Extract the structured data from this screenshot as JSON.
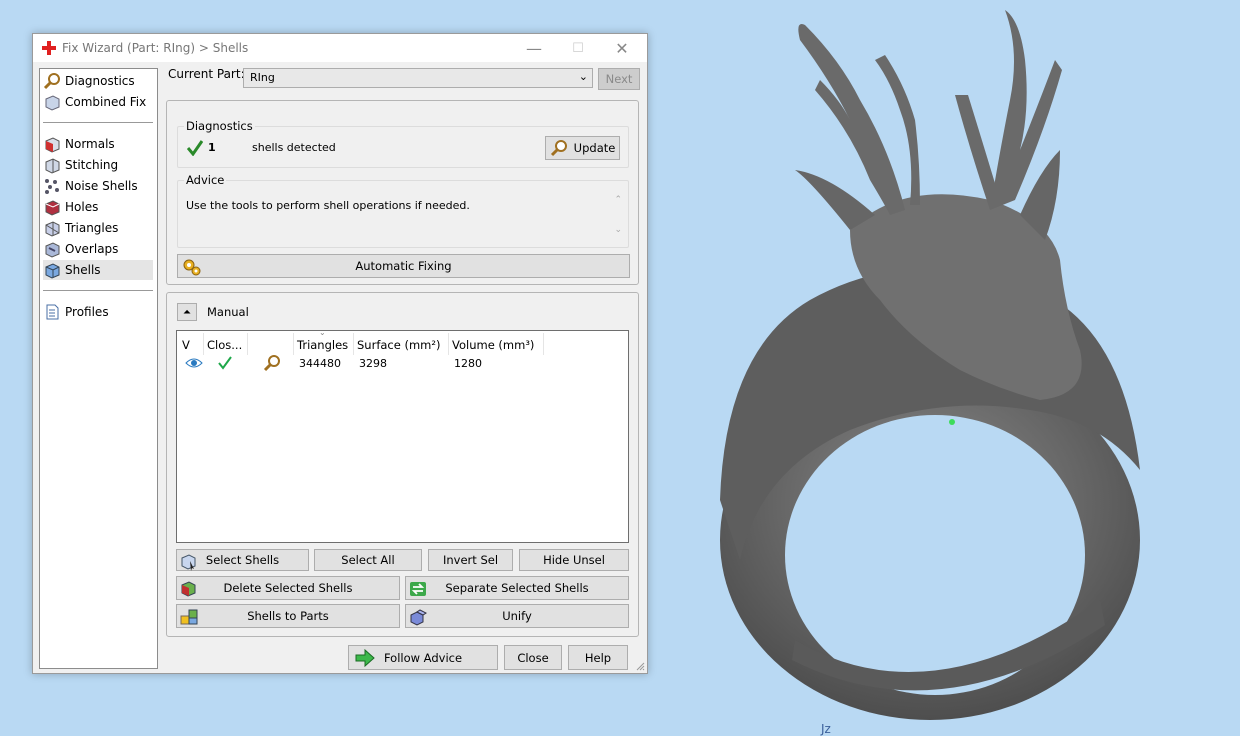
{
  "window": {
    "title": "Fix Wizard (Part: RIng) > Shells",
    "minimize": "—",
    "maximize": "☐",
    "close": "✕"
  },
  "sidebar": {
    "items": [
      {
        "label": "Diagnostics",
        "icon": "magnifier-icon"
      },
      {
        "label": "Combined Fix",
        "icon": "combined-fix-icon"
      },
      {
        "label": "Normals",
        "icon": "normals-icon"
      },
      {
        "label": "Stitching",
        "icon": "stitching-icon"
      },
      {
        "label": "Noise Shells",
        "icon": "noise-shells-icon"
      },
      {
        "label": "Holes",
        "icon": "holes-icon"
      },
      {
        "label": "Triangles",
        "icon": "triangles-icon"
      },
      {
        "label": "Overlaps",
        "icon": "overlaps-icon"
      },
      {
        "label": "Shells",
        "icon": "shells-icon"
      },
      {
        "label": "Profiles",
        "icon": "profiles-icon"
      }
    ],
    "selected": "Shells"
  },
  "current_part": {
    "label": "Current Part:",
    "value": "RIng",
    "next_label": "Next"
  },
  "diagnostics": {
    "title": "Diagnostics",
    "count": "1",
    "text": "shells detected",
    "update_label": "Update"
  },
  "advice": {
    "title": "Advice",
    "text": "Use the tools to perform shell operations if needed."
  },
  "automatic_fixing_label": "Automatic Fixing",
  "manual": {
    "title": "Manual",
    "table": {
      "columns": [
        "V",
        "Clos...",
        "",
        "Triangles",
        "Surface (mm²)",
        "Volume (mm³)"
      ],
      "rows": [
        {
          "visible_icon": "eye-icon",
          "closed_icon": "check-icon",
          "zoom_icon": "magnifier-icon",
          "triangles": "344480",
          "surface": "3298",
          "volume": "1280"
        }
      ]
    },
    "buttons": {
      "select_shells": "Select Shells",
      "select_all": "Select All",
      "invert_sel": "Invert Sel",
      "hide_unsel": "Hide Unsel",
      "delete_selected": "Delete Selected Shells",
      "separate_selected": "Separate Selected Shells",
      "shells_to_parts": "Shells to Parts",
      "unify": "Unify"
    }
  },
  "footer": {
    "follow_advice": "Follow Advice",
    "close": "Close",
    "help": "Help"
  },
  "viewport": {
    "axis_label": "Jz",
    "background": "#b9d9f3",
    "model_color": "#6b6b6b"
  }
}
